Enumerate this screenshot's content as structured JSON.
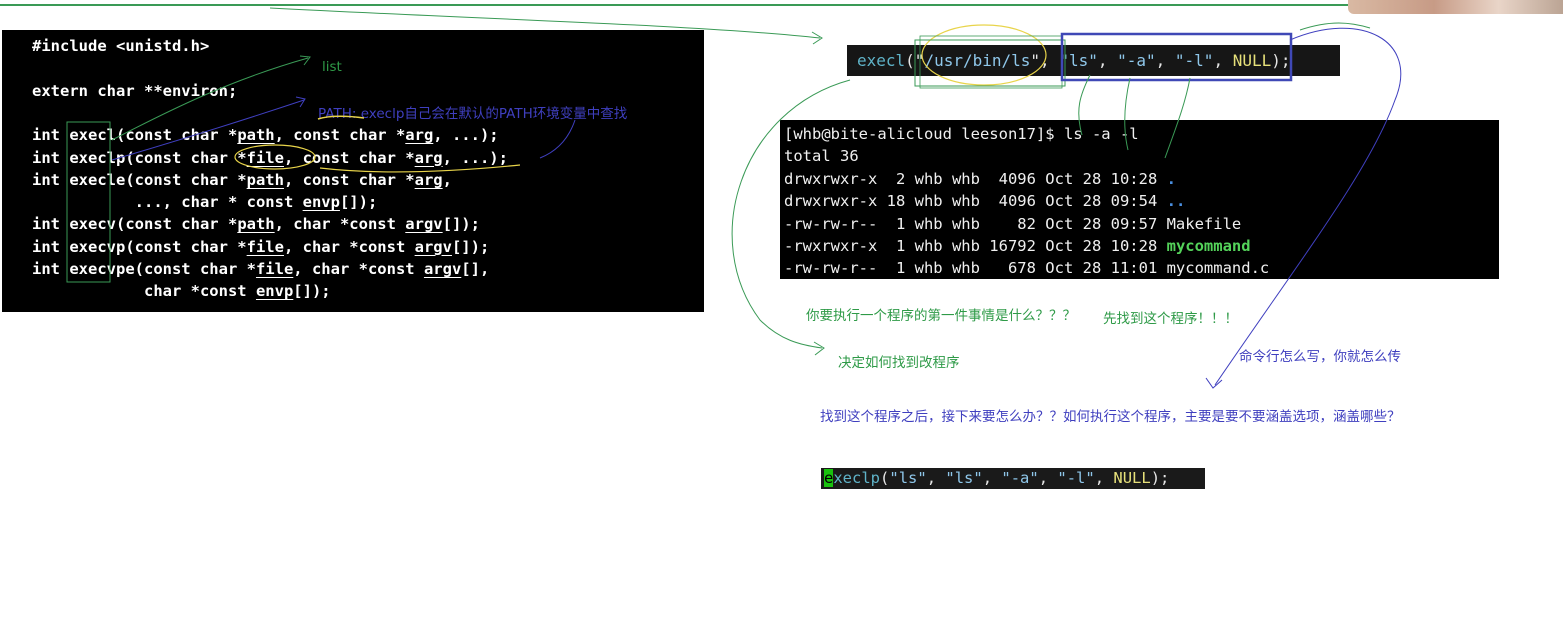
{
  "code_panel": {
    "lines": [
      [
        "#include <unistd.h>"
      ],
      [],
      [
        "extern char **environ;"
      ],
      [],
      [
        "int execl(const char *",
        {
          "u": "path"
        },
        ", const char *",
        {
          "u": "arg"
        },
        ", ...);"
      ],
      [
        "int execlp(const char *",
        {
          "u": "file"
        },
        ", const char *",
        {
          "u": "arg"
        },
        ", ...);"
      ],
      [
        "int execle(const char *",
        {
          "u": "path"
        },
        ", const char *",
        {
          "u": "arg"
        },
        ","
      ],
      [
        "           ..., char * const ",
        {
          "u": "envp"
        },
        "[]);"
      ],
      [
        "int execv(const char *",
        {
          "u": "path"
        },
        ", char *const ",
        {
          "u": "argv"
        },
        "[]);"
      ],
      [
        "int execvp(const char *",
        {
          "u": "file"
        },
        ", char *const ",
        {
          "u": "argv"
        },
        "[]);"
      ],
      [
        "int execvpe(const char *",
        {
          "u": "file"
        },
        ", char *const ",
        {
          "u": "argv"
        },
        "[],"
      ],
      [
        "            char *const ",
        {
          "u": "envp"
        },
        "[]);"
      ]
    ]
  },
  "execl_call": [
    {
      "t": "execl",
      "c": "fn"
    },
    {
      "t": "(\"",
      "c": "punc"
    },
    {
      "t": "/usr/bin/ls",
      "c": "str"
    },
    {
      "t": "\", ",
      "c": "punc"
    },
    {
      "t": "\"ls\"",
      "c": "str"
    },
    {
      "t": ", ",
      "c": "punc"
    },
    {
      "t": "\"-a\"",
      "c": "str"
    },
    {
      "t": ", ",
      "c": "punc"
    },
    {
      "t": "\"-l\"",
      "c": "str"
    },
    {
      "t": ", ",
      "c": "punc"
    },
    {
      "t": "NULL",
      "c": "kw"
    },
    {
      "t": ");",
      "c": "punc"
    }
  ],
  "terminal": {
    "lines": [
      [
        {
          "t": "[whb@bite-alicloud leeson17]$ ls -a -l"
        }
      ],
      [
        {
          "t": "total 36"
        }
      ],
      [
        {
          "t": "drwxrwxr-x  2 whb whb  4096 Oct 28 10:28 "
        },
        {
          "t": ".",
          "c": "dir"
        }
      ],
      [
        {
          "t": "drwxrwxr-x 18 whb whb  4096 Oct 28 09:54 "
        },
        {
          "t": "..",
          "c": "dir"
        }
      ],
      [
        {
          "t": "-rw-rw-r--  1 whb whb    82 Oct 28 09:57 Makefile"
        }
      ],
      [
        {
          "t": "-rwxrwxr-x  1 whb whb 16792 Oct 28 10:28 "
        },
        {
          "t": "mycommand",
          "c": "exec"
        }
      ],
      [
        {
          "t": "-rw-rw-r--  1 whb whb   678 Oct 28 11:01 mycommand.c"
        }
      ]
    ]
  },
  "annotations": {
    "list_label": "list",
    "path_note": "PATH:  execlp自己会在默认的PATH环境变量中查找",
    "question_first": "你要执行一个程序的第一件事情是什么？？？",
    "answer_first": "先找到这个程序！！！",
    "decide_how": "决定如何找到改程序",
    "cmdline_note": "命令行怎么写，你就怎么传",
    "question_next": "找到这个程序之后，接下来要怎么办？？如何执行这个程序，主要是要不要涵盖选项，涵盖哪些？"
  },
  "execlp_call": [
    {
      "t": "e",
      "c": "cursor"
    },
    {
      "t": "xeclp",
      "c": "fn"
    },
    {
      "t": "(",
      "c": "punc"
    },
    {
      "t": "\"ls\"",
      "c": "str"
    },
    {
      "t": ", ",
      "c": "punc"
    },
    {
      "t": "\"ls\"",
      "c": "str"
    },
    {
      "t": ", ",
      "c": "punc"
    },
    {
      "t": "\"-a\"",
      "c": "str"
    },
    {
      "t": ", ",
      "c": "punc"
    },
    {
      "t": "\"-l\"",
      "c": "str"
    },
    {
      "t": ", ",
      "c": "punc"
    },
    {
      "t": "NULL",
      "c": "kw"
    },
    {
      "t": ");",
      "c": "punc"
    }
  ],
  "colors": {
    "annotation_green": "#2e9a47",
    "annotation_blue": "#3f3fbf",
    "highlight_yellow": "#e8d44a",
    "terminal_dir": "#4a8fe0",
    "terminal_exec": "#54d35a"
  }
}
